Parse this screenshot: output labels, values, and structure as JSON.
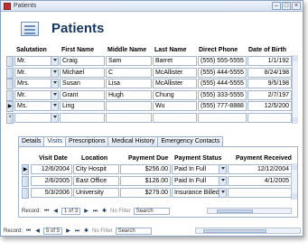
{
  "window": {
    "title": "Patients"
  },
  "form": {
    "heading": "Patients"
  },
  "main": {
    "columns": [
      "Salutation",
      "First Name",
      "Middle Name",
      "Last Name",
      "Direct Phone",
      "Date of Birth"
    ],
    "rows": [
      {
        "selector": "",
        "salutation": "Mr.",
        "first": "Craig",
        "middle": "Sam",
        "last": "Barret",
        "phone": "(555) 555-5555",
        "dob": "1/1/192"
      },
      {
        "selector": "",
        "salutation": "Mr.",
        "first": "Michael",
        "middle": "C",
        "last": "McAllister",
        "phone": "(555) 444-5555",
        "dob": "8/24/198"
      },
      {
        "selector": "",
        "salutation": "Mrs.",
        "first": "Susan",
        "middle": "Lisa",
        "last": "McAllister",
        "phone": "(555) 444-5555",
        "dob": "9/5/198"
      },
      {
        "selector": "",
        "salutation": "Mr.",
        "first": "Grant",
        "middle": "Hugh",
        "last": "Chung",
        "phone": "(555) 333-5555",
        "dob": "2/7/197"
      },
      {
        "selector": "▶",
        "salutation": "Ms.",
        "first": "Ling",
        "middle": "",
        "last": "Wu",
        "phone": "(555) 777-8888",
        "dob": "12/5/200"
      },
      {
        "selector": "*",
        "salutation": "",
        "first": "",
        "middle": "",
        "last": "",
        "phone": "",
        "dob": ""
      }
    ]
  },
  "tabs": [
    "Details",
    "Visits",
    "Prescriptions",
    "Medical History",
    "Emergency Contacts"
  ],
  "active_tab": "Visits",
  "visits": {
    "columns": [
      "Visit Date",
      "Location",
      "Payment Due",
      "Payment Status",
      "Payment Received"
    ],
    "rows": [
      {
        "selector": "▶",
        "date": "12/6/2004",
        "location": "City Hospit",
        "due": "$256.00",
        "status": "Paid In Full",
        "received": "12/12/2004"
      },
      {
        "selector": "",
        "date": "2/6/2005",
        "location": "East Office",
        "due": "$126.00",
        "status": "Paid In Full",
        "received": "4/1/2005"
      },
      {
        "selector": "",
        "date": "5/3/2006",
        "location": "University",
        "due": "$279.00",
        "status": "Insurance Billed",
        "received": ""
      }
    ]
  },
  "subnav": {
    "record_label": "Record:",
    "position": "1 of 3",
    "filter": "No Filter",
    "search": "Search"
  },
  "mainnav": {
    "record_label": "Record:",
    "position": "5 of 5",
    "filter": "No Filter",
    "search": "Search"
  }
}
